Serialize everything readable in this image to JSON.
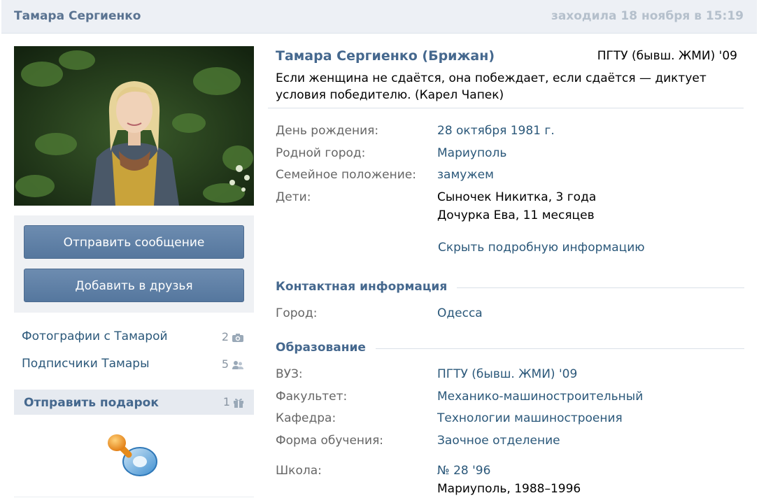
{
  "header": {
    "name": "Тамара Сергиенко",
    "last_seen": "заходила 18 ноября в 15:19"
  },
  "sidebar": {
    "buttons": {
      "send_message": "Отправить сообщение",
      "add_friend": "Добавить в друзья"
    },
    "links": [
      {
        "label": "Фотографии с Тамарой",
        "count": "2",
        "icon": "camera-icon"
      },
      {
        "label": "Подписчики Тамары",
        "count": "5",
        "icon": "people-icon"
      }
    ],
    "gifts": {
      "label": "Отправить подарок",
      "count": "1",
      "icon": "gift-icon",
      "item_icon": "pacifier-icon"
    }
  },
  "profile": {
    "full_name": "Тамара Сергиенко (Брижан)",
    "university_short": "ПГТУ (бывш. ЖМИ) '09",
    "status": "Если женщина не сдаётся, она побеждает, если сдаётся — диктует условия победителю. (Карел Чапек)",
    "info": {
      "birthday": {
        "label": "День рождения:",
        "value": "28 октября 1981 г."
      },
      "hometown": {
        "label": "Родной город:",
        "value": "Мариуполь"
      },
      "marital": {
        "label": "Семейное положение:",
        "value": "замужем"
      },
      "children": {
        "label": "Дети:",
        "values": [
          "Сыночек Никитка, 3 года",
          "Дочурка Ева, 11 месяцев"
        ]
      }
    },
    "hide_details": "Скрыть подробную информацию",
    "contacts": {
      "title": "Контактная информация",
      "city": {
        "label": "Город:",
        "value": "Одесса"
      }
    },
    "education": {
      "title": "Образование",
      "university": {
        "label": "ВУЗ:",
        "value": "ПГТУ (бывш. ЖМИ) '09"
      },
      "faculty": {
        "label": "Факультет:",
        "value": "Механико-машиностроительный"
      },
      "department": {
        "label": "Кафедра:",
        "value": "Технологии машиностроения"
      },
      "study_form": {
        "label": "Форма обучения:",
        "value": "Заочное отделение"
      },
      "school": {
        "label": "Школа:",
        "value": "№ 28 '96",
        "details": "Мариуполь, 1988–1996"
      }
    }
  },
  "colors": {
    "accent": "#45688e",
    "link": "#2b587a",
    "button": "#5d7ea5"
  }
}
